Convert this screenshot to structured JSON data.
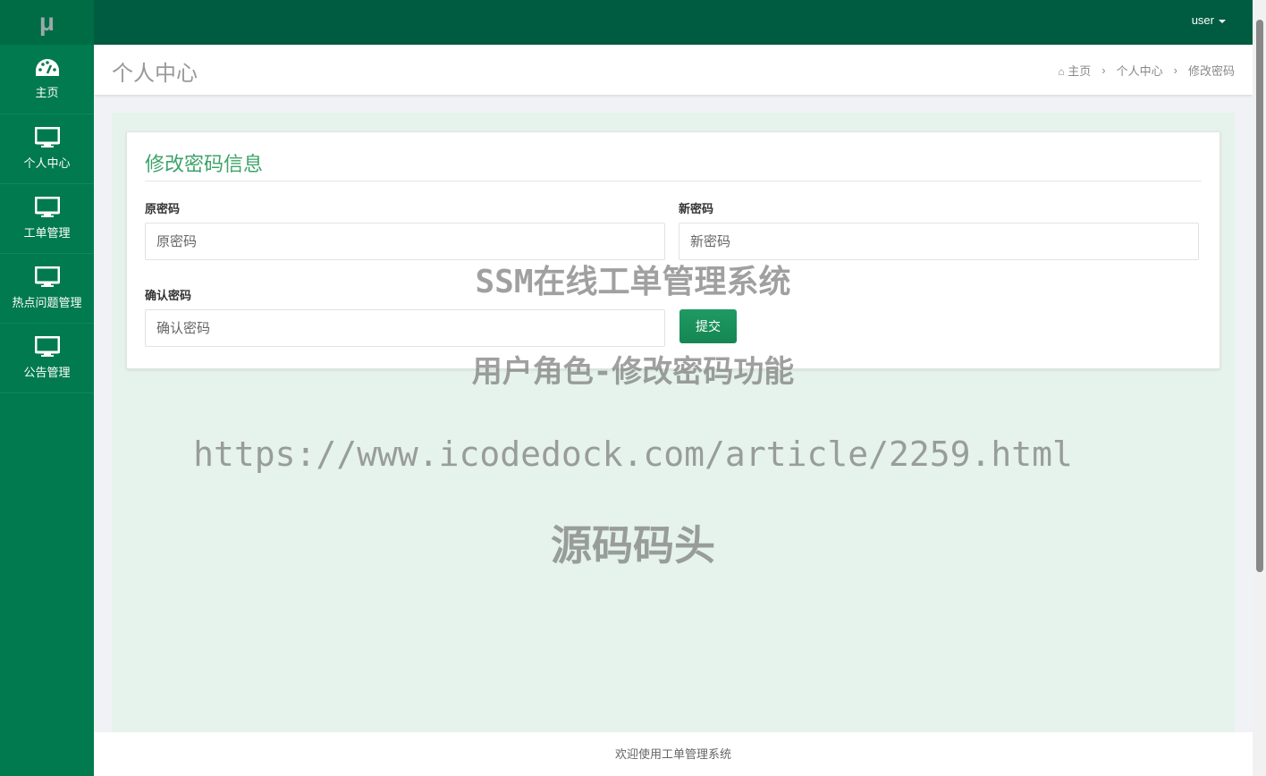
{
  "logo": "μ",
  "sidebar": {
    "items": [
      {
        "label": "主页",
        "icon": "dashboard-icon"
      },
      {
        "label": "个人中心",
        "icon": "monitor-icon"
      },
      {
        "label": "工单管理",
        "icon": "monitor-icon"
      },
      {
        "label": "热点问题管理",
        "icon": "monitor-icon"
      },
      {
        "label": "公告管理",
        "icon": "monitor-icon"
      }
    ]
  },
  "topbar": {
    "user": "user"
  },
  "header": {
    "title": "个人中心",
    "breadcrumb": [
      "主页",
      "个人中心",
      "修改密码"
    ]
  },
  "form": {
    "title": "修改密码信息",
    "old_label": "原密码",
    "old_placeholder": "原密码",
    "new_label": "新密码",
    "new_placeholder": "新密码",
    "confirm_label": "确认密码",
    "confirm_placeholder": "确认密码",
    "submit": "提交"
  },
  "watermark": {
    "line1": "SSM在线工单管理系统",
    "line2": "用户角色-修改密码功能",
    "line3": "https://www.icodedock.com/article/2259.html",
    "line4": "源码码头"
  },
  "footer": "欢迎使用工单管理系统",
  "colors": {
    "sidebar": "#007a4e",
    "topbar": "#005c40",
    "accent": "#3da36a"
  }
}
